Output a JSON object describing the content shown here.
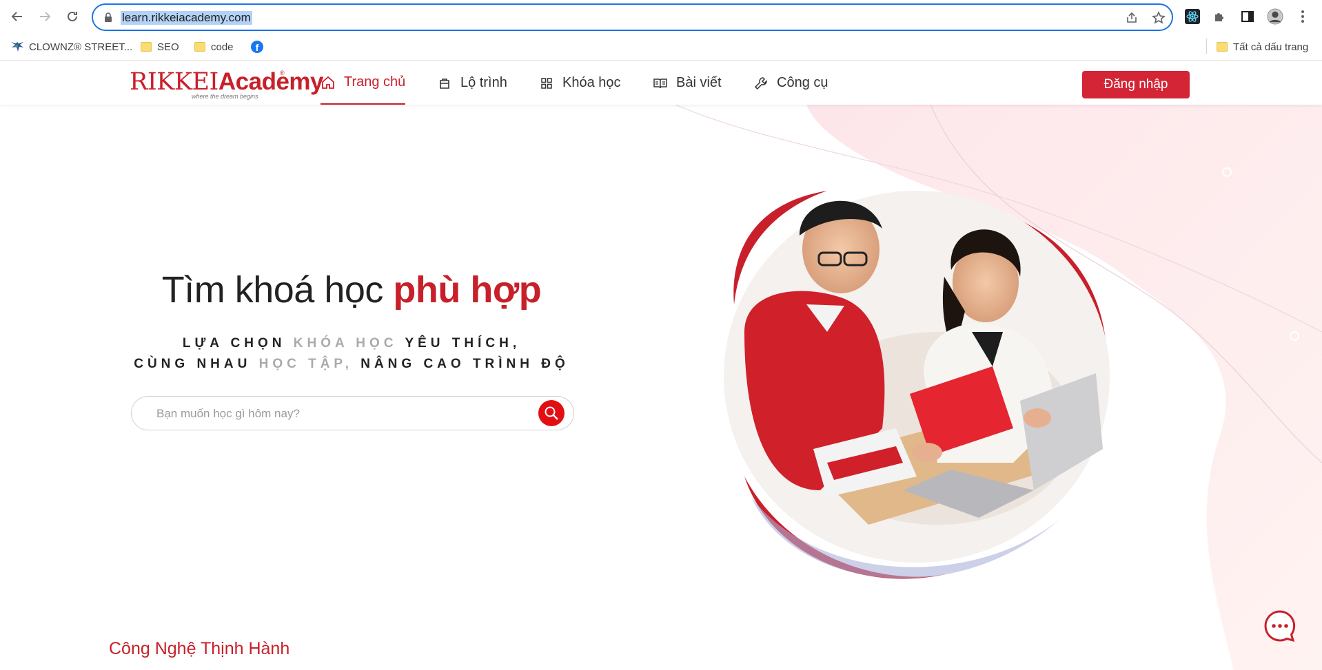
{
  "browser": {
    "url": "learn.rikkeiacademy.com",
    "bookmarks": [
      {
        "label": "CLOWNZ® STREET...",
        "icon": "clownz-logo-icon"
      },
      {
        "label": "SEO",
        "icon": "folder-icon"
      },
      {
        "label": "code",
        "icon": "folder-icon"
      },
      {
        "label": "",
        "icon": "facebook-icon"
      }
    ],
    "all_bookmarks_label": "Tất cả dấu trang"
  },
  "site": {
    "logo": {
      "text": "RIKKEI",
      "academy": "Academy",
      "tagline": "where the dream begins",
      "reg": "®"
    },
    "menu": [
      {
        "label": "Trang chủ",
        "icon": "home-icon",
        "active": true
      },
      {
        "label": "Lộ trình",
        "icon": "bag-icon",
        "active": false
      },
      {
        "label": "Khóa học",
        "icon": "grid-icon",
        "active": false
      },
      {
        "label": "Bài viết",
        "icon": "book-icon",
        "active": false
      },
      {
        "label": "Công cụ",
        "icon": "wrench-icon",
        "active": false
      }
    ],
    "login_label": "Đăng nhập",
    "colors": {
      "brand": "#c8202a",
      "button": "#d32535",
      "search_button": "#e10f14"
    }
  },
  "hero": {
    "title_plain": "Tìm khoá học ",
    "title_accent": "phù hợp",
    "subtitle_line1_a": "LỰA CHỌN ",
    "subtitle_line1_b": "KHÓA HỌC",
    "subtitle_line1_c": " YÊU THÍCH,",
    "subtitle_line2_a": "CÙNG NHAU ",
    "subtitle_line2_b": "HỌC TẬP,",
    "subtitle_line2_c": " NÂNG CAO TRÌNH ĐỘ",
    "search_placeholder": "Bạn muốn học gì hôm nay?",
    "search_value": ""
  },
  "section": {
    "title": "Công Nghệ Thịnh Hành"
  }
}
